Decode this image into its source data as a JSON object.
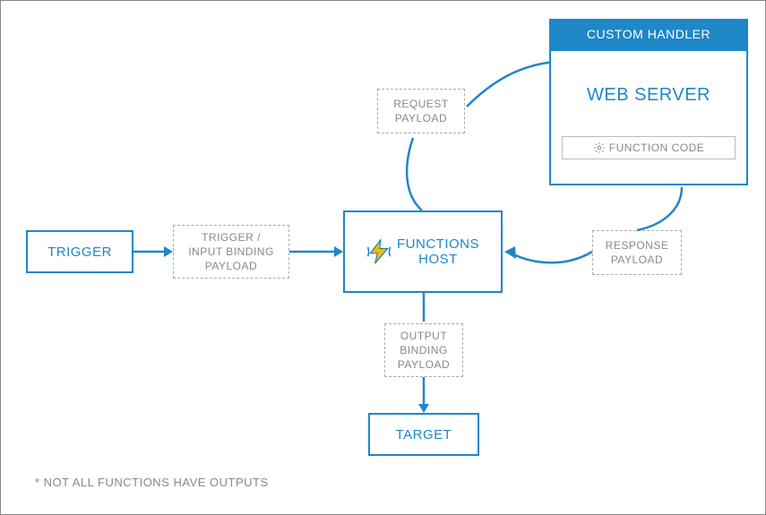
{
  "diagram": {
    "trigger_label": "TRIGGER",
    "input_payload_label": "TRIGGER /\nINPUT BINDING\nPAYLOAD",
    "functions_host_label": "FUNCTIONS\nHOST",
    "request_payload_label": "REQUEST\nPAYLOAD",
    "custom_handler_header": "CUSTOM HANDLER",
    "web_server_label": "WEB SERVER",
    "function_code_label": "FUNCTION CODE",
    "response_payload_label": "RESPONSE\nPAYLOAD",
    "output_payload_label": "OUTPUT\nBINDING\nPAYLOAD",
    "target_label": "TARGET",
    "footnote": "* NOT ALL FUNCTIONS HAVE OUTPUTS"
  },
  "colors": {
    "primary": "#1e87c8",
    "muted": "#888"
  }
}
